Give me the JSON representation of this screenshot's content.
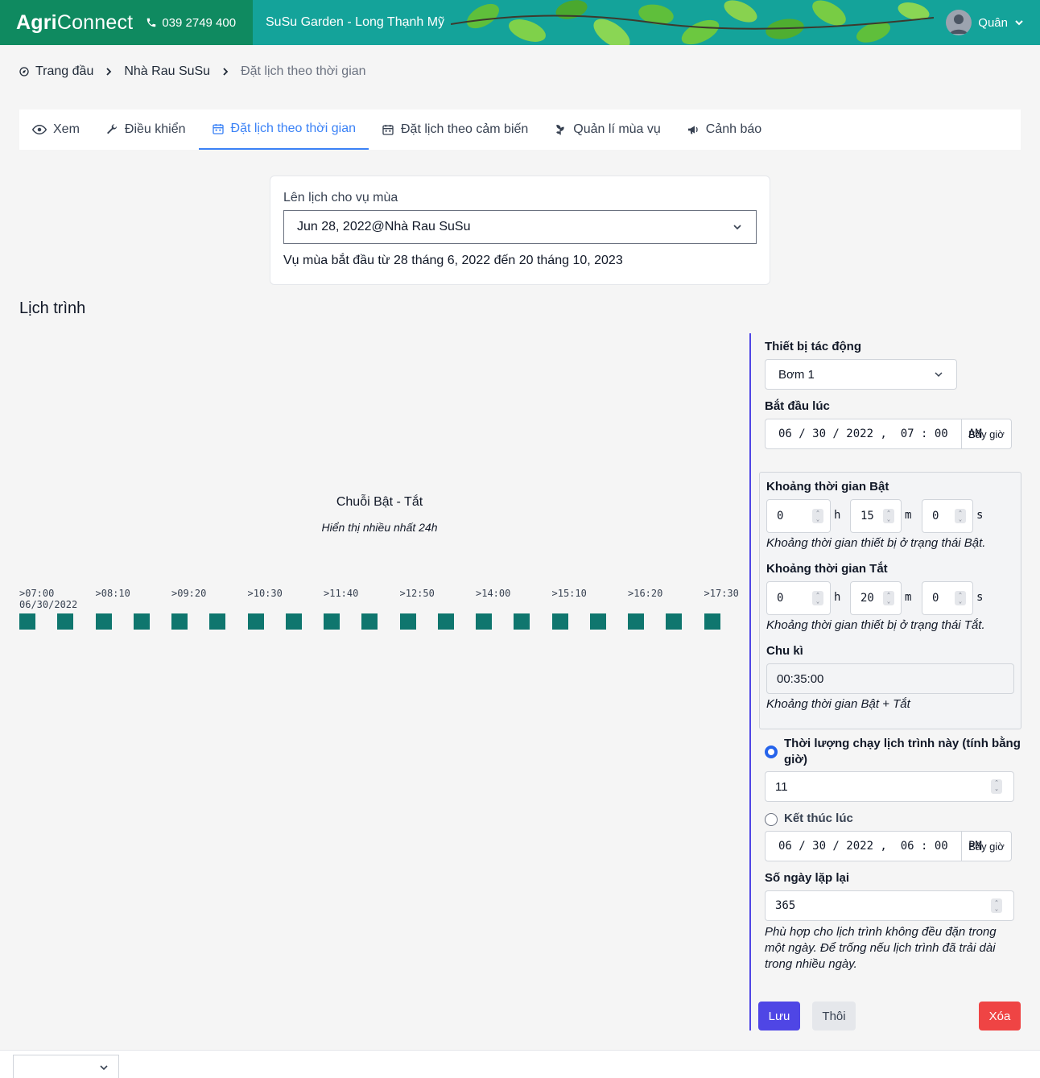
{
  "header": {
    "logo_bold": "Agri",
    "logo_light": "Connect",
    "phone": "039 2749 400",
    "garden": "SuSu Garden - Long Thạnh Mỹ",
    "user_name": "Quân"
  },
  "breadcrumb": {
    "home": "Trang đầu",
    "farm": "Nhà Rau SuSu",
    "current": "Đặt lịch theo thời gian"
  },
  "tabs": [
    {
      "label": "Xem",
      "icon": "eye-icon"
    },
    {
      "label": "Điều khiển",
      "icon": "wrench-icon"
    },
    {
      "label": "Đặt lịch theo thời gian",
      "icon": "calendar-icon"
    },
    {
      "label": "Đặt lịch theo cảm biến",
      "icon": "calendar-icon"
    },
    {
      "label": "Quản lí mùa vụ",
      "icon": "sprout-icon"
    },
    {
      "label": "Cảnh báo",
      "icon": "megaphone-icon"
    }
  ],
  "season": {
    "label": "Lên lịch cho vụ mùa",
    "selected": "Jun 28, 2022@Nhà Rau SuSu",
    "range": "Vụ mùa bắt đầu từ 28 tháng 6, 2022 đến 20 tháng 10, 2023"
  },
  "schedule": {
    "title": "Lịch trình",
    "chart_title": "Chuỗi Bật - Tắt",
    "chart_subtitle": "Hiển thị nhiều nhất 24h",
    "ticks": [
      ">07:00",
      ">08:10",
      ">09:20",
      ">10:30",
      ">11:40",
      ">12:50",
      ">14:00",
      ">15:10",
      ">16:20",
      ">17:30"
    ],
    "date": "06/30/2022",
    "on_block_count": 19
  },
  "form": {
    "device_label": "Thiết bị tác động",
    "device_value": "Bơm 1",
    "start_label": "Bắt đầu lúc",
    "start_value": "06 / 30 / 2022 ,  07 : 00   AM",
    "now_label": "Bây giờ",
    "on_duration_label": "Khoảng thời gian Bật",
    "on_h": "0",
    "on_m": "15",
    "on_s": "0",
    "on_note": "Khoảng thời gian thiết bị ở trạng thái Bật.",
    "off_duration_label": "Khoảng thời gian Tắt",
    "off_h": "0",
    "off_m": "20",
    "off_s": "0",
    "off_note": "Khoảng thời gian thiết bị ở trạng thái Tắt.",
    "unit_h": "h",
    "unit_m": "m",
    "unit_s": "s",
    "cycle_label": "Chu kì",
    "cycle_value": "00:35:00",
    "cycle_note": "Khoảng thời gian Bật + Tắt",
    "duration_radio_label": "Thời lượng chạy lịch trình này (tính bằng giờ)",
    "duration_value": "11",
    "end_radio_label": "Kết thúc lúc",
    "end_value": "06 / 30 / 2022 ,  06 : 00   PM",
    "repeat_label": "Số ngày lặp lại",
    "repeat_value": "365",
    "repeat_note": "Phù hợp cho lịch trình không đều đặn trong một ngày. Để trống nếu lịch trình đã trải dài trong nhiều ngày.",
    "save": "Lưu",
    "cancel": "Thôi",
    "delete": "Xóa"
  },
  "colors": {
    "header": "#14a39a",
    "brand": "#0f8a60",
    "accent": "#3b82f6",
    "block": "#0f766e",
    "save": "#4f46e5",
    "delete": "#ef4444"
  }
}
